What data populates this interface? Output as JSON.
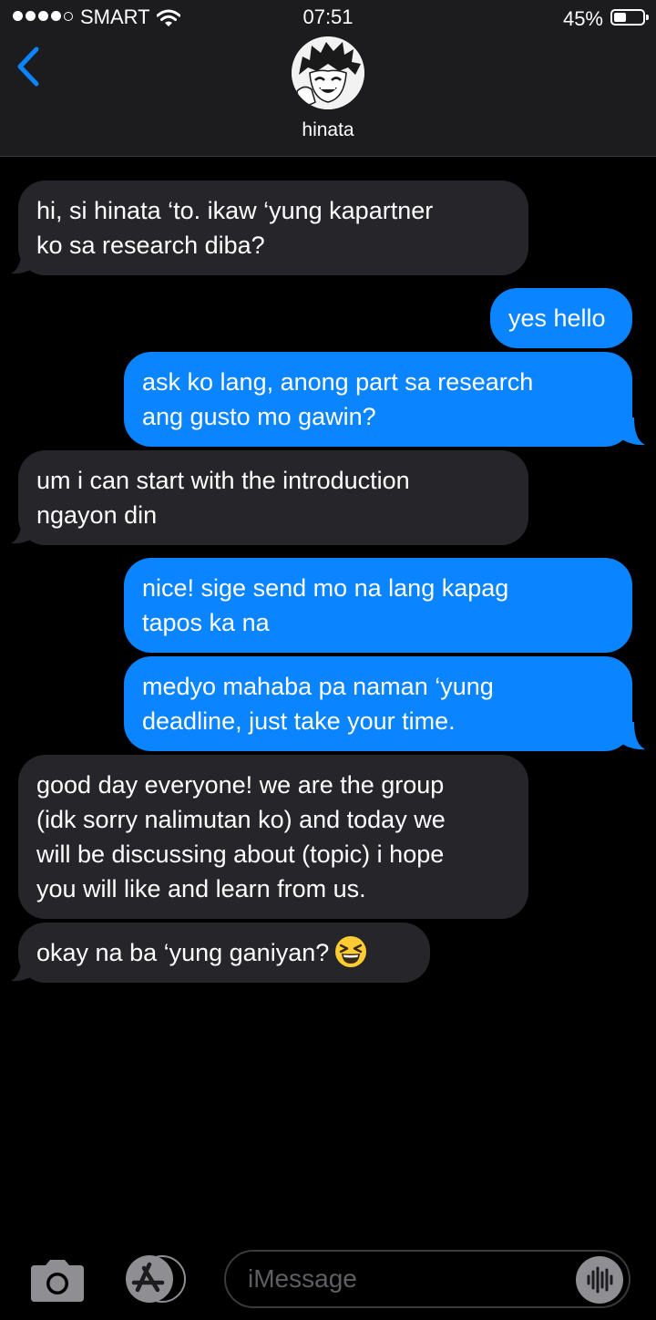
{
  "status_bar": {
    "carrier": "SMART",
    "time": "07:51",
    "battery_percent": "45%",
    "battery_level": 0.45,
    "signal_bars_filled": 4,
    "signal_bars_total": 5
  },
  "header": {
    "contact_name": "hinata",
    "back_icon": "chevron-left-icon",
    "avatar_icon": "contact-avatar"
  },
  "messages": [
    {
      "direction": "incoming",
      "lines": [
        "hi, si hinata ‘to. ikaw ‘yung kapartner",
        "ko sa research diba?"
      ]
    },
    {
      "direction": "outgoing",
      "lines": [
        "yes hello"
      ]
    },
    {
      "direction": "outgoing",
      "lines": [
        "ask ko lang, anong part sa research",
        "ang gusto mo gawin?"
      ]
    },
    {
      "direction": "incoming",
      "lines": [
        "um i can start with the introduction",
        "ngayon din"
      ]
    },
    {
      "direction": "outgoing",
      "lines": [
        "nice! sige send mo na lang kapag",
        "tapos ka na"
      ]
    },
    {
      "direction": "outgoing",
      "lines": [
        "medyo mahaba pa naman ‘yung",
        "deadline, just take your time."
      ]
    },
    {
      "direction": "incoming",
      "lines": [
        "good day everyone! we are the group",
        "(idk sorry nalimutan ko) and today we",
        "will be discussing about (topic) i hope",
        "you will like and learn from us."
      ]
    },
    {
      "direction": "incoming",
      "lines": [
        "okay na ba ‘yung ganiyan?"
      ],
      "emoji": "grinning-squinting-face"
    }
  ],
  "input_bar": {
    "placeholder": "iMessage",
    "camera_icon": "camera-icon",
    "appstore_icon": "app-store-icon",
    "audio_icon": "audio-waveform-icon"
  },
  "colors": {
    "header_bg": "#1c1c1e",
    "incoming_bubble": "#26252a",
    "outgoing_bubble": "#0a84ff",
    "accent": "#0a84ff",
    "icon_gray": "#8e8e93"
  }
}
